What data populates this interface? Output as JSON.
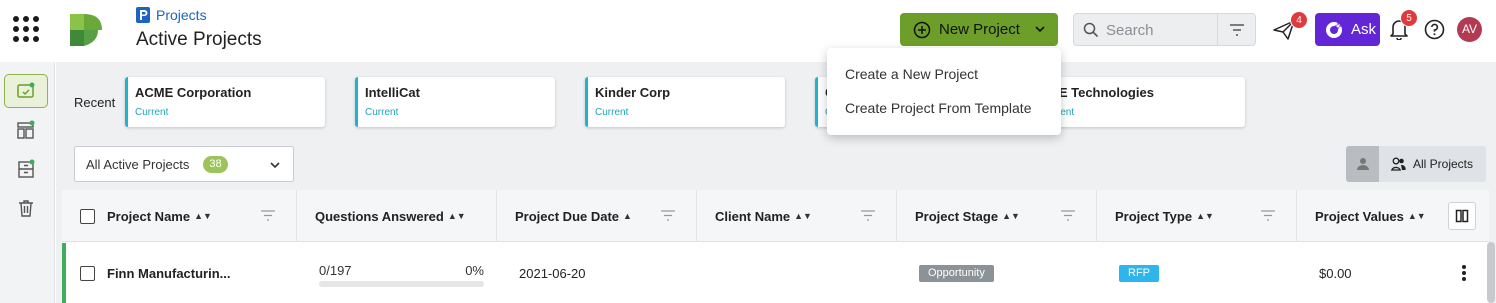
{
  "header": {
    "breadcrumb": "Projects",
    "title": "Active Projects",
    "new_project_label": "New Project",
    "search_placeholder": "Search",
    "send_badge": "4",
    "ask_label": "Ask",
    "notification_badge": "5",
    "avatar_initials": "AV"
  },
  "new_project_menu": {
    "items": [
      "Create a New Project",
      "Create Project From Template"
    ]
  },
  "rail": {
    "items": [
      "projects-icon",
      "dashboard-icon",
      "archive-icon",
      "trash-icon"
    ]
  },
  "recent": {
    "label": "Recent",
    "cards": [
      {
        "name": "ACME Corporation",
        "status": "Current"
      },
      {
        "name": "IntelliCat",
        "status": "Current"
      },
      {
        "name": "Kinder Corp",
        "status": "Current"
      },
      {
        "name": "C",
        "status": "C"
      },
      {
        "name": "ME Technologies",
        "status": "urrent"
      }
    ]
  },
  "filter": {
    "selected": "All Active Projects",
    "count": "38"
  },
  "view_toggle": {
    "all_label": "All Projects"
  },
  "table": {
    "columns": [
      "Project Name",
      "Questions Answered",
      "Project Due Date",
      "Client Name",
      "Project Stage",
      "Project Type",
      "Project Values"
    ],
    "rows": [
      {
        "name": "Finn Manufacturin...",
        "answered": "0/197",
        "percent": "0%",
        "progress": 0,
        "due_date": "2021-06-20",
        "client": "",
        "stage": "Opportunity",
        "type": "RFP",
        "value": "$0.00"
      }
    ]
  },
  "colors": {
    "brand_green": "#6e9e2a",
    "ask_purple": "#6326d6",
    "badge_red": "#e0393e",
    "accent_teal": "#1fb3cc",
    "stage_gray": "#8c9398",
    "type_blue": "#2eb6ec"
  }
}
